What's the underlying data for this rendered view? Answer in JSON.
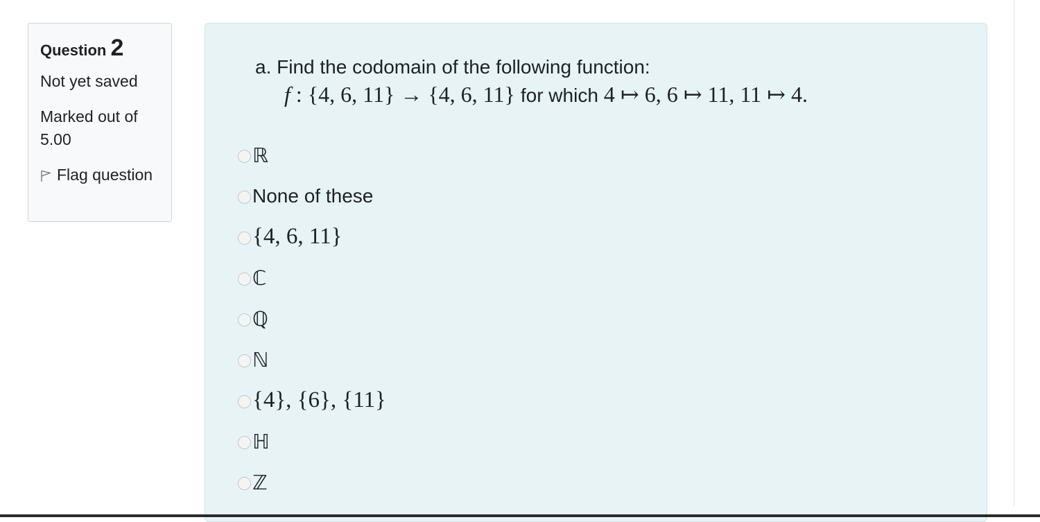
{
  "question_info": {
    "label": "Question",
    "number": "2",
    "state": "Not yet saved",
    "grade": "Marked out of 5.00",
    "flag_label": "Flag question"
  },
  "question_text": {
    "prefix": "a.",
    "line1": "Find the codomain of the following function:",
    "func_name": "f",
    "mapping": " : {4, 6, 11} → {4, 6, 11} ",
    "for_which": "for which",
    "rule": " 4 ↦ 6, 6 ↦ 11, 11 ↦ 4."
  },
  "answers": [
    {
      "label": "ℝ"
    },
    {
      "label": "None of these"
    },
    {
      "label": "{4, 6, 11}"
    },
    {
      "label": "ℂ"
    },
    {
      "label": "ℚ"
    },
    {
      "label": "ℕ"
    },
    {
      "label": "{4}, {6}, {11}"
    },
    {
      "label": "ℍ"
    },
    {
      "label": "ℤ"
    }
  ]
}
